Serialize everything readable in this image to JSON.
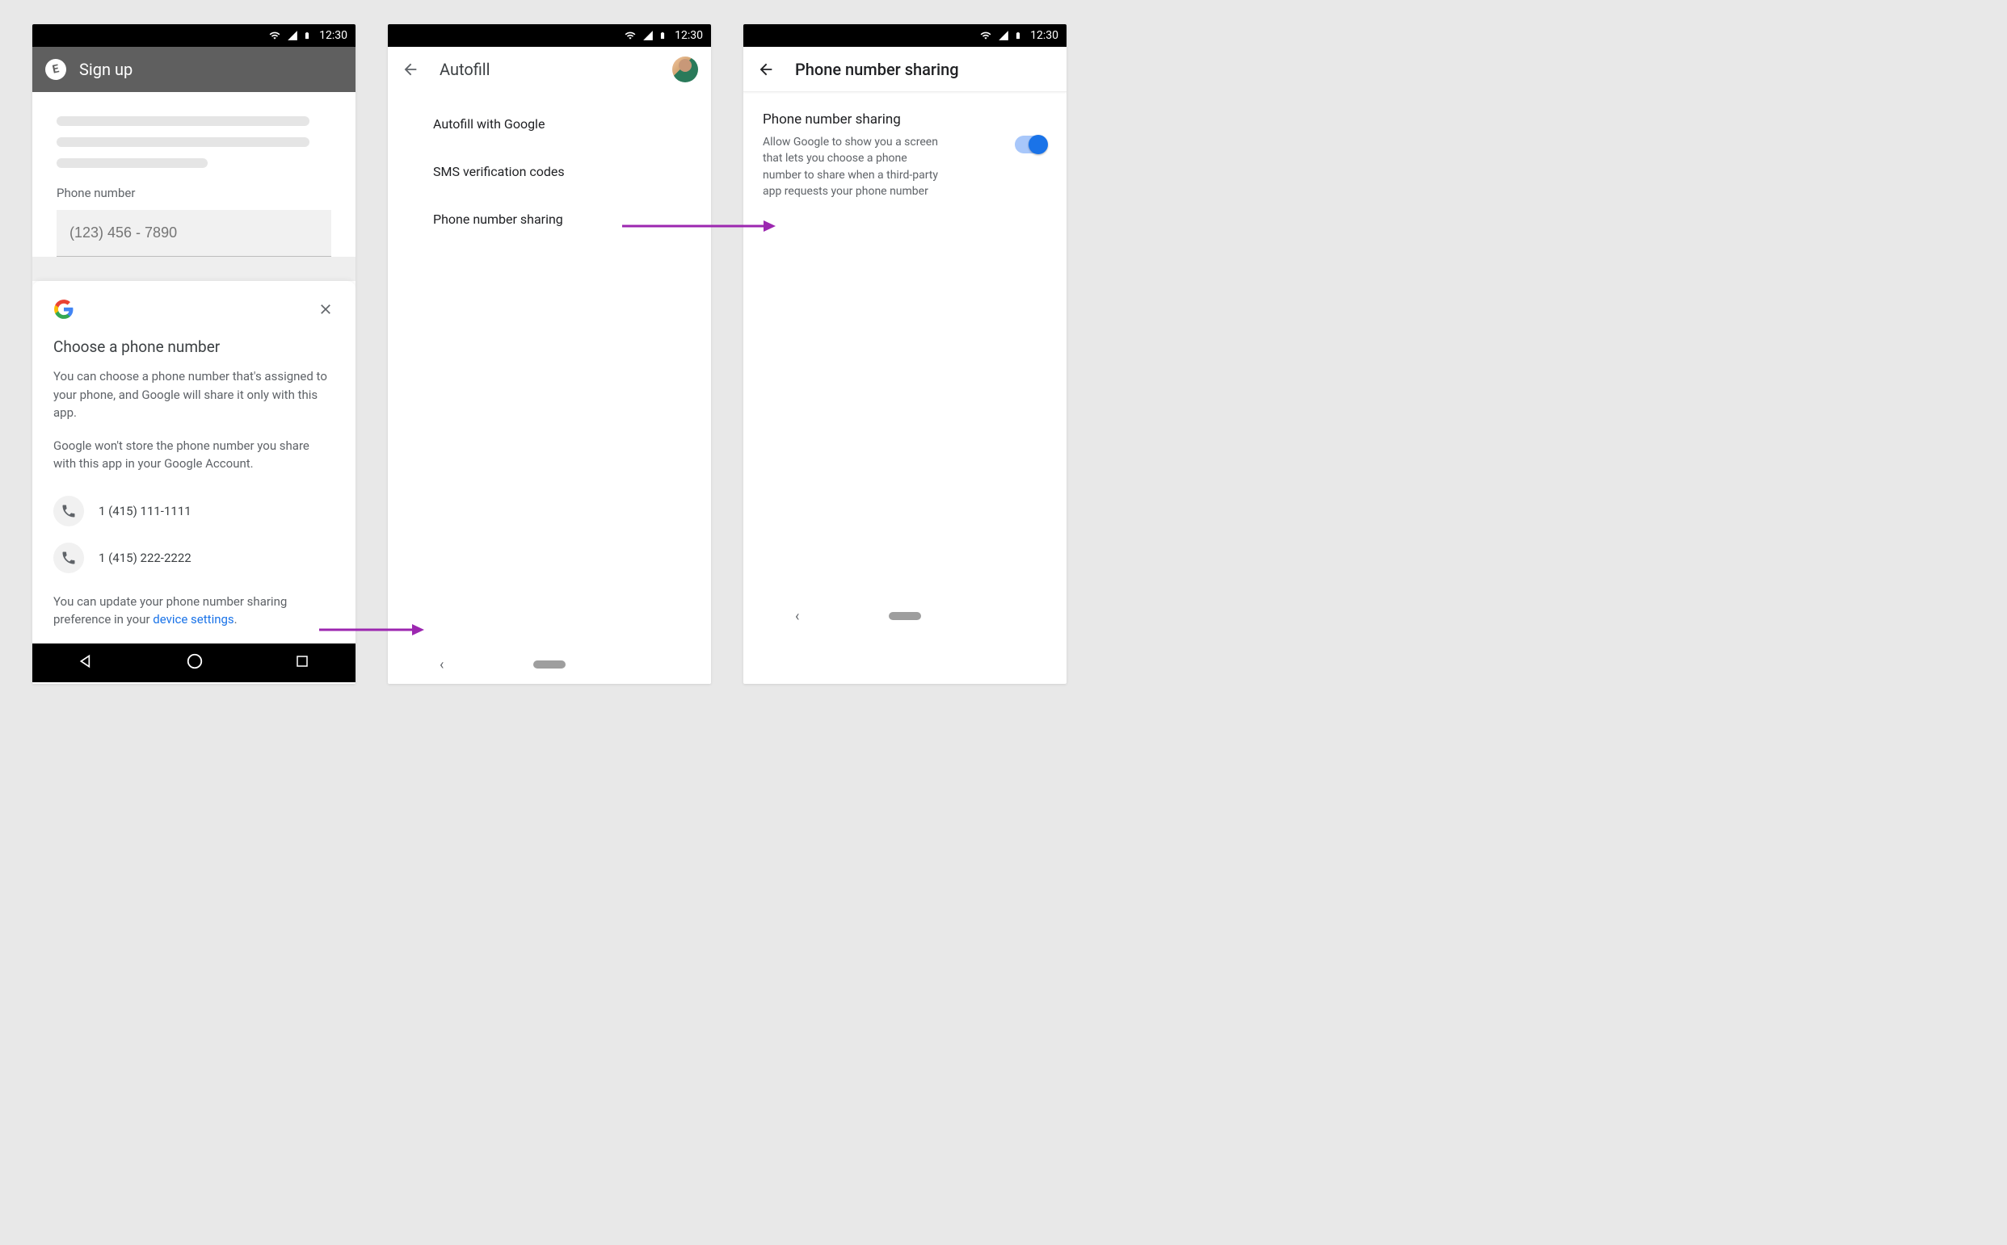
{
  "status": {
    "time": "12:30"
  },
  "screen1": {
    "app_title": "Sign up",
    "logo_letter": "E",
    "field_label": "Phone number",
    "phone_placeholder": "(123) 456 - 7890",
    "sheet": {
      "title": "Choose a phone number",
      "p1": "You can choose a phone number that's assigned to your phone, and Google will share it only with this app.",
      "p2": "Google won't store the phone number you share with this app in your Google Account.",
      "numbers": [
        "1 (415) 111-1111",
        "1 (415) 222-2222"
      ],
      "footer_pre": "You can update your phone number sharing preference in your ",
      "footer_link": "device settings",
      "footer_post": "."
    }
  },
  "screen2": {
    "title": "Autofill",
    "items": [
      "Autofill with Google",
      "SMS verification codes",
      "Phone number sharing"
    ]
  },
  "screen3": {
    "title": "Phone number sharing",
    "setting_title": "Phone number sharing",
    "setting_desc": "Allow Google to show you a screen that lets you choose a phone number to share when a third-party app requests your phone number"
  }
}
